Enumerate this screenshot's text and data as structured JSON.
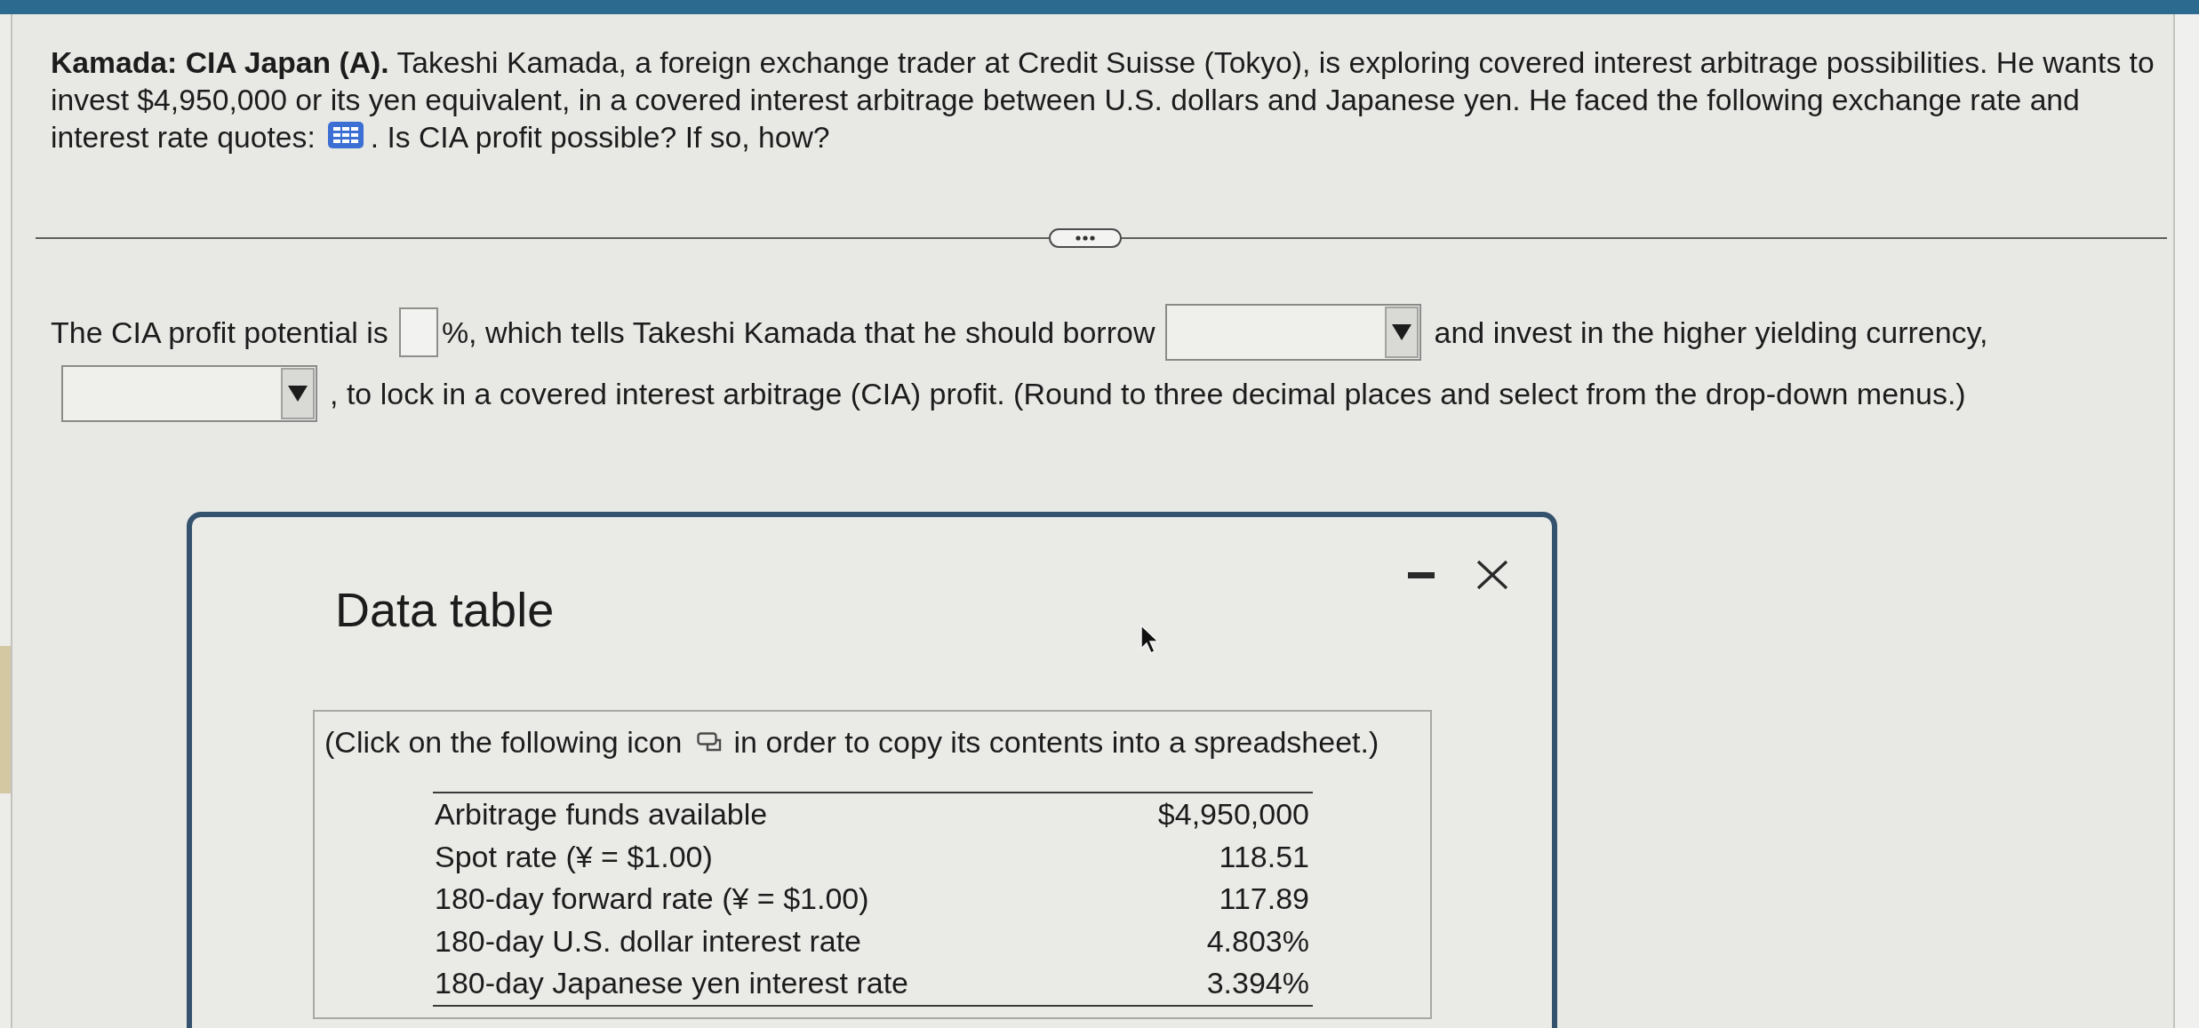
{
  "question": {
    "intro": "**Kamada: CIA Japan (A).** Takeshi Kamada, a foreign exchange trader at Credit Suisse (Tokyo), is exploring covered interest arbitrage possibilities. He wants to invest $4,950,000 or its yen equivalent, in a covered interest arbitrage between U.S. dollars and Japanese yen. He faced the following exchange rate and",
    "text_before_icon": "interest rate quotes:",
    "text_after_icon": ". Is CIA profit possible? If so, how?"
  },
  "answer": {
    "parts": [
      {
        "kind": "text",
        "text": "The CIA profit potential is"
      },
      {
        "kind": "number_input"
      },
      {
        "kind": "text",
        "text": "%, which tells Takeshi Kamada that he should borrow"
      },
      {
        "kind": "dropdown"
      },
      {
        "kind": "text",
        "text": "and invest in the higher yielding currency,"
      },
      {
        "kind": "dropdown"
      },
      {
        "kind": "text",
        "text": ", to lock in a covered interest arbitrage (CIA) profit. (Round to three decimal places and select from the drop-down menus.)"
      }
    ]
  },
  "data_table": {
    "title": "Data table",
    "instruction_before_icon": "(Click on the following icon",
    "instruction_after_icon": "in order to copy its contents into a spreadsheet.)",
    "rows": [
      {
        "label": "Arbitrage funds available",
        "value": "$4,950,000"
      },
      {
        "label": "Spot rate (¥ = $1.00)",
        "value": "118.51"
      },
      {
        "label": "180-day forward rate (¥ = $1.00)",
        "value": "117.89"
      },
      {
        "label": "180-day U.S. dollar interest rate",
        "value": "4.803%"
      },
      {
        "label": "180-day Japanese yen interest rate",
        "value": "3.394%"
      }
    ]
  }
}
